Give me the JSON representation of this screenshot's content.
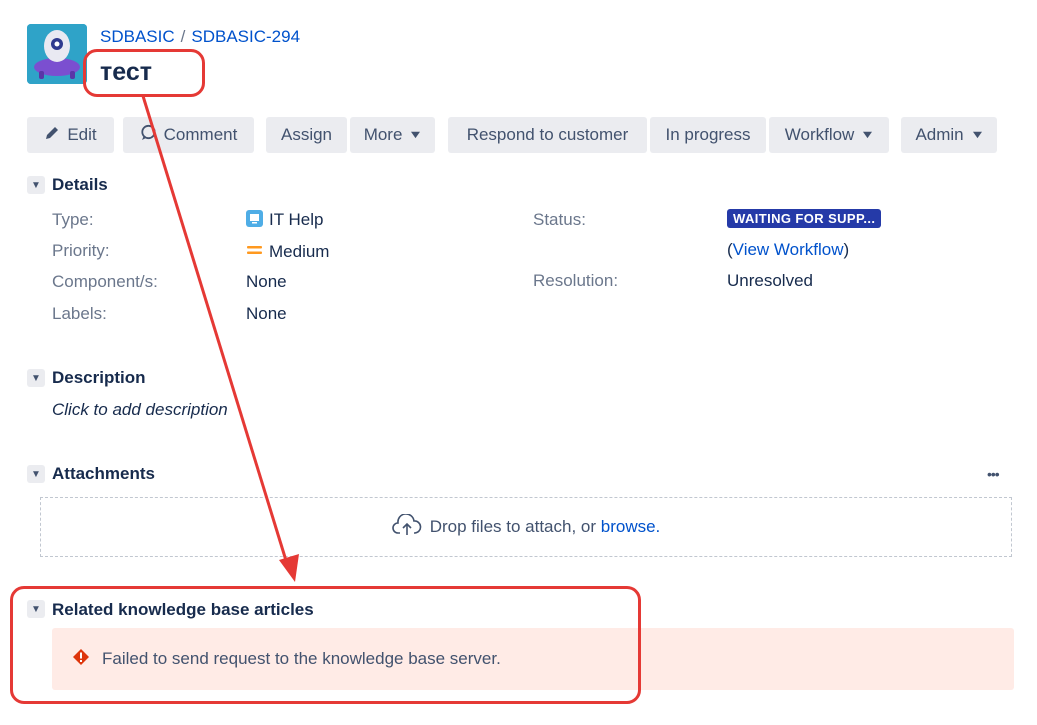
{
  "breadcrumb": {
    "project": "SDBASIC",
    "separator": "/",
    "issue_key": "SDBASIC-294"
  },
  "issue": {
    "title": "тест"
  },
  "toolbar": {
    "edit": "Edit",
    "comment": "Comment",
    "assign": "Assign",
    "more": "More",
    "respond": "Respond to customer",
    "in_progress": "In progress",
    "workflow": "Workflow",
    "admin": "Admin"
  },
  "details": {
    "heading": "Details",
    "type_label": "Type:",
    "type_value": "IT Help",
    "priority_label": "Priority:",
    "priority_value": "Medium",
    "components_label": "Component/s:",
    "components_value": "None",
    "labels_label": "Labels:",
    "labels_value": "None",
    "status_label": "Status:",
    "status_value": "WAITING FOR SUPP...",
    "view_workflow_open": "(",
    "view_workflow": "View Workflow",
    "view_workflow_close": ")",
    "resolution_label": "Resolution:",
    "resolution_value": "Unresolved"
  },
  "description": {
    "heading": "Description",
    "placeholder": "Click to add description"
  },
  "attachments": {
    "heading": "Attachments",
    "more_icon": "•••",
    "drop_text": "Drop files to attach, or ",
    "browse": "browse."
  },
  "kb": {
    "heading": "Related knowledge base articles",
    "error": "Failed to send request to the knowledge base server."
  },
  "colors": {
    "link": "#0052cc",
    "status_badge": "#253aa8",
    "annotation": "#e53935",
    "error_bg": "#ffebe6",
    "priority": "#ff991f"
  },
  "icons": {
    "edit": "pencil-icon",
    "comment": "comment-icon",
    "type": "it-help-icon",
    "priority": "medium-priority-icon",
    "upload": "cloud-upload-icon",
    "error": "error-icon"
  }
}
